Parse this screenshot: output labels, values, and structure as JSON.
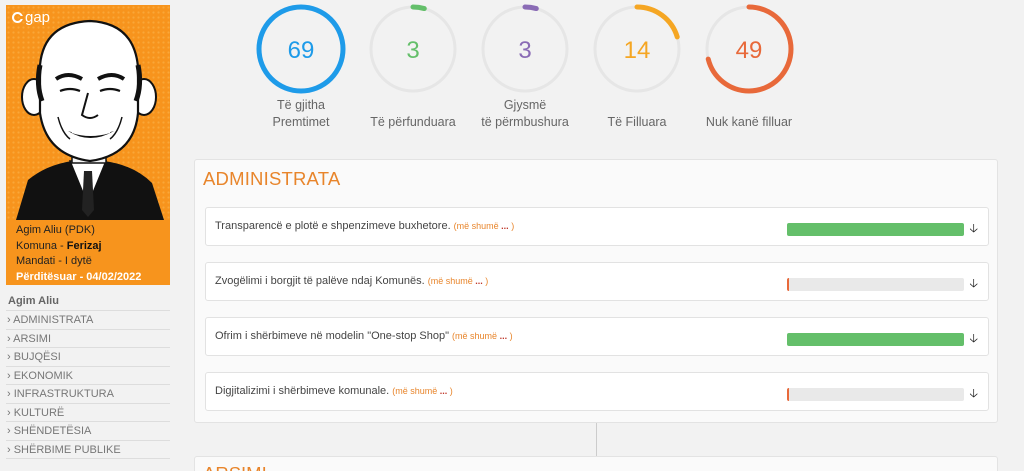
{
  "profile": {
    "logo_text": "gap",
    "name_line": "Agim Aliu (PDK)",
    "municipality_label": "Komuna - ",
    "municipality": "Ferizaj",
    "term": "Mandati - I dytë",
    "updated": "Përditësuar - 04/02/2022"
  },
  "sidebar": {
    "owner": "Agim Aliu",
    "items": [
      {
        "label": "› ADMINISTRATA"
      },
      {
        "label": "› ARSIMI"
      },
      {
        "label": "› BUJQËSI"
      },
      {
        "label": "› EKONOMIK"
      },
      {
        "label": "› INFRASTRUKTURA"
      },
      {
        "label": "› KULTURË"
      },
      {
        "label": "› SHËNDETËSIA"
      },
      {
        "label": "› SHËRBIME PUBLIKE"
      }
    ]
  },
  "stats": [
    {
      "value": "69",
      "fraction": 1.0,
      "color": "#1e9be9",
      "label_line1": "Të gjitha",
      "label_line2": "Premtimet"
    },
    {
      "value": "3",
      "fraction": 0.0435,
      "color": "#64bf6a",
      "label_line1": "",
      "label_line2": "Të përfunduara"
    },
    {
      "value": "3",
      "fraction": 0.0435,
      "color": "#8a6bb5",
      "label_line1": "Gjysmë",
      "label_line2": "të përmbushura"
    },
    {
      "value": "14",
      "fraction": 0.2029,
      "color": "#f5a623",
      "label_line1": "",
      "label_line2": "Të Filluara"
    },
    {
      "value": "49",
      "fraction": 0.7101,
      "color": "#e8693a",
      "label_line1": "",
      "label_line2": "Nuk kanë filluar"
    }
  ],
  "section": {
    "title": "ADMINISTRATA",
    "more_label": "(më shumë",
    "more_dots": "...",
    "more_close": ")",
    "rows": [
      {
        "text": "Transparencë e plotë e shpenzimeve buxhetore.",
        "progress": 1.0,
        "status": "completed"
      },
      {
        "text": "Zvogëlimi i borgjit të palëve ndaj Komunës.",
        "progress": 0.0,
        "status": "started"
      },
      {
        "text": "Ofrim i shërbimeve në modelin \"One-stop Shop\"",
        "progress": 1.0,
        "status": "completed"
      },
      {
        "text": "Digjitalizimi i shërbimeve komunale.",
        "progress": 0.0,
        "status": "started"
      }
    ]
  },
  "next_section": {
    "title": "ARSIMI"
  },
  "icons": {
    "expand": "arrow-down-icon"
  }
}
